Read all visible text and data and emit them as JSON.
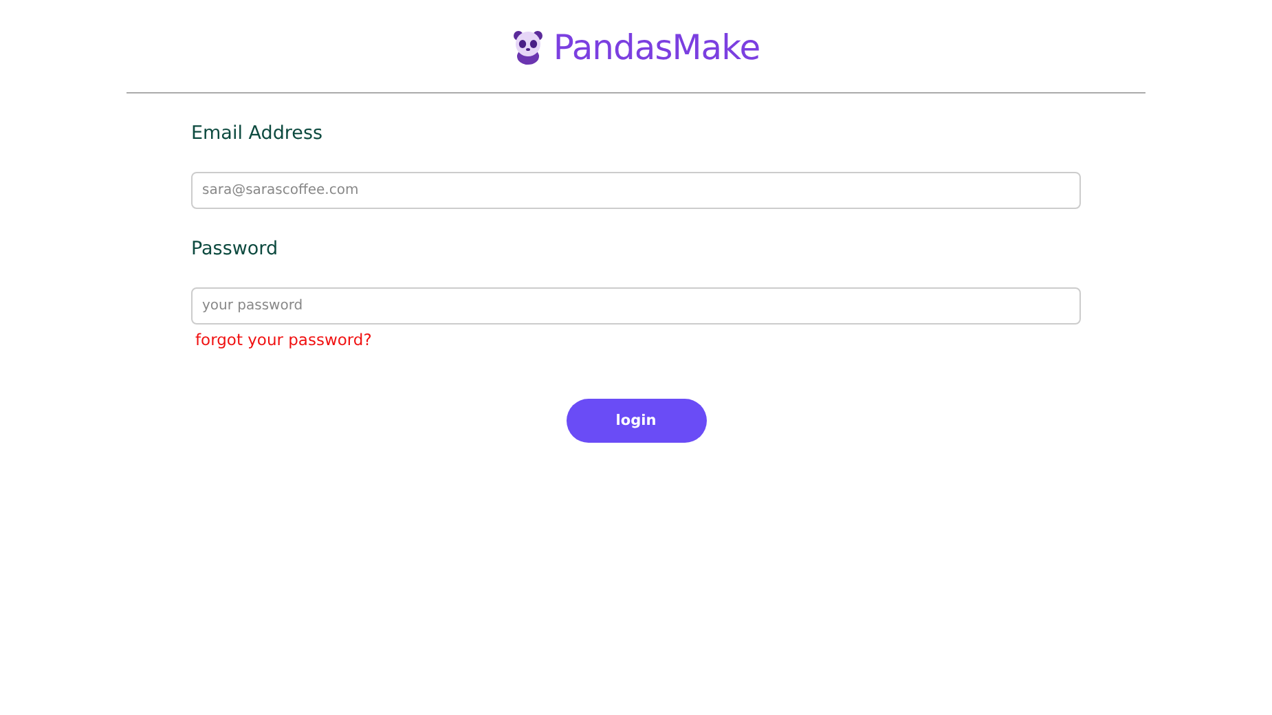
{
  "brand": {
    "name": "PandasMake"
  },
  "fields": [
    {
      "label": "Email Address",
      "placeholder": "sara@sarascoffee.com"
    },
    {
      "label": "Password",
      "placeholder": "your password"
    }
  ],
  "forgot_link": "forgot your password?",
  "login_button": "login"
}
